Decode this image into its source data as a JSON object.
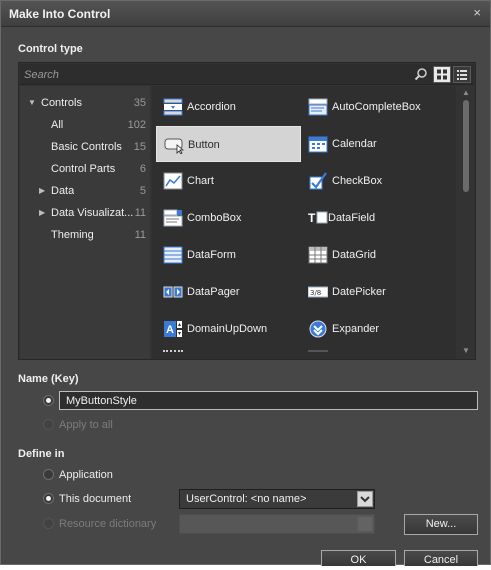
{
  "dialog": {
    "title": "Make Into Control",
    "close_glyph": "×"
  },
  "control_type": {
    "label": "Control type",
    "search": {
      "placeholder": "Search",
      "value": ""
    },
    "view_modes": [
      "grid-view-icon",
      "list-view-icon"
    ],
    "categories": [
      {
        "label": "Controls",
        "count": "35",
        "expanded": true,
        "arrow": "▼"
      },
      {
        "label": "All",
        "count": "102"
      },
      {
        "label": "Basic Controls",
        "count": "15"
      },
      {
        "label": "Control Parts",
        "count": "6"
      },
      {
        "label": "Data",
        "count": "5",
        "arrow": "▶"
      },
      {
        "label": "Data Visualizat...",
        "count": "11",
        "arrow": "▶"
      },
      {
        "label": "Theming",
        "count": "11"
      }
    ],
    "items": [
      {
        "label": "Accordion",
        "icon": "accordion-icon"
      },
      {
        "label": "AutoCompleteBox",
        "icon": "autocompletebox-icon"
      },
      {
        "label": "Button",
        "icon": "button-icon",
        "selected": true
      },
      {
        "label": "Calendar",
        "icon": "calendar-icon"
      },
      {
        "label": "Chart",
        "icon": "chart-icon"
      },
      {
        "label": "CheckBox",
        "icon": "checkbox-icon"
      },
      {
        "label": "ComboBox",
        "icon": "combobox-icon"
      },
      {
        "label": "DataField",
        "icon": "datafield-icon",
        "icon_text": "T"
      },
      {
        "label": "DataForm",
        "icon": "dataform-icon"
      },
      {
        "label": "DataGrid",
        "icon": "datagrid-icon"
      },
      {
        "label": "DataPager",
        "icon": "datapager-icon"
      },
      {
        "label": "DatePicker",
        "icon": "datepicker-icon",
        "icon_text": "3/8"
      },
      {
        "label": "DomainUpDown",
        "icon": "domainupdown-icon",
        "icon_text": "A"
      },
      {
        "label": "Expander",
        "icon": "expander-icon"
      }
    ]
  },
  "name_key": {
    "label": "Name (Key)",
    "value": "MyButtonStyle",
    "apply_to_all": "Apply to all"
  },
  "define_in": {
    "label": "Define in",
    "application": "Application",
    "this_document": "This document",
    "document_combo": "UserControl: <no name>",
    "resource_dictionary": "Resource dictionary",
    "new_button": "New..."
  },
  "footer": {
    "ok": "OK",
    "cancel": "Cancel"
  },
  "colors": {
    "dialog_bg": "#474747",
    "selected_item": "#d4d4d4",
    "accent_blue": "#3a7bd5"
  }
}
